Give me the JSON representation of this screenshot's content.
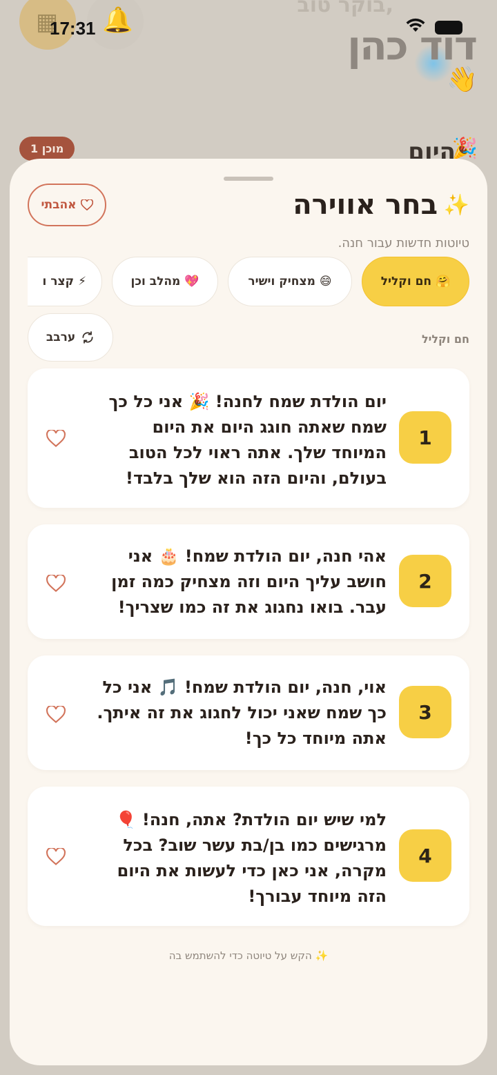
{
  "status_bar": {
    "time": "17:31"
  },
  "background": {
    "greeting": "בוקר טוב,",
    "name": "דוד כהן",
    "wave_emoji": "👋",
    "section_title": "היום",
    "section_emoji": "🎉",
    "ready_badge": "1 מוכן"
  },
  "sheet": {
    "title": "בחר אווירה",
    "title_sparkle": "✨",
    "favorites_label": "אהבתי",
    "subtitle": "טיוטות חדשות עבור חנה.",
    "tones": [
      {
        "emoji": "🤗",
        "label": "חם וקליל",
        "selected": true
      },
      {
        "emoji": "😄",
        "label": "מצחיק וישיר",
        "selected": false
      },
      {
        "emoji": "💖",
        "label": "מהלב וכן",
        "selected": false
      },
      {
        "emoji": "⚡",
        "label": "קצר ו",
        "selected": false
      }
    ],
    "current_tone": "חם וקליל",
    "shuffle_label": "ערבב",
    "drafts": [
      {
        "number": "1",
        "text": "יום הולדת שמח לחנה! 🎉 אני כל כך שמח שאתה חוגג היום את היום המיוחד שלך. אתה ראוי לכל הטוב בעולם, והיום הזה הוא שלך בלבד!"
      },
      {
        "number": "2",
        "text": "אהי חנה, יום הולדת שמח! 🎂 אני חושב עליך היום וזה מצחיק כמה זמן עבר. בואו נחגוג את זה כמו שצריך!"
      },
      {
        "number": "3",
        "text": "אוי, חנה, יום הולדת שמח! 🎵 אני כל כך שמח שאני יכול לחגוג את זה איתך. אתה מיוחד כל כך!"
      },
      {
        "number": "4",
        "text": "למי שיש יום הולדת? אתה, חנה! 🎈 מרגישים כמו בן/בת עשר שוב? בכל מקרה, אני כאן כדי לעשות את היום הזה מיוחד עבורך!"
      }
    ],
    "hint_sparkle": "✨",
    "hint": "הקש על טיוטה כדי להשתמש בה"
  },
  "colors": {
    "accent_yellow": "#f7cf45",
    "accent_coral": "#d2745b",
    "sheet_bg": "#fbf6ef"
  }
}
